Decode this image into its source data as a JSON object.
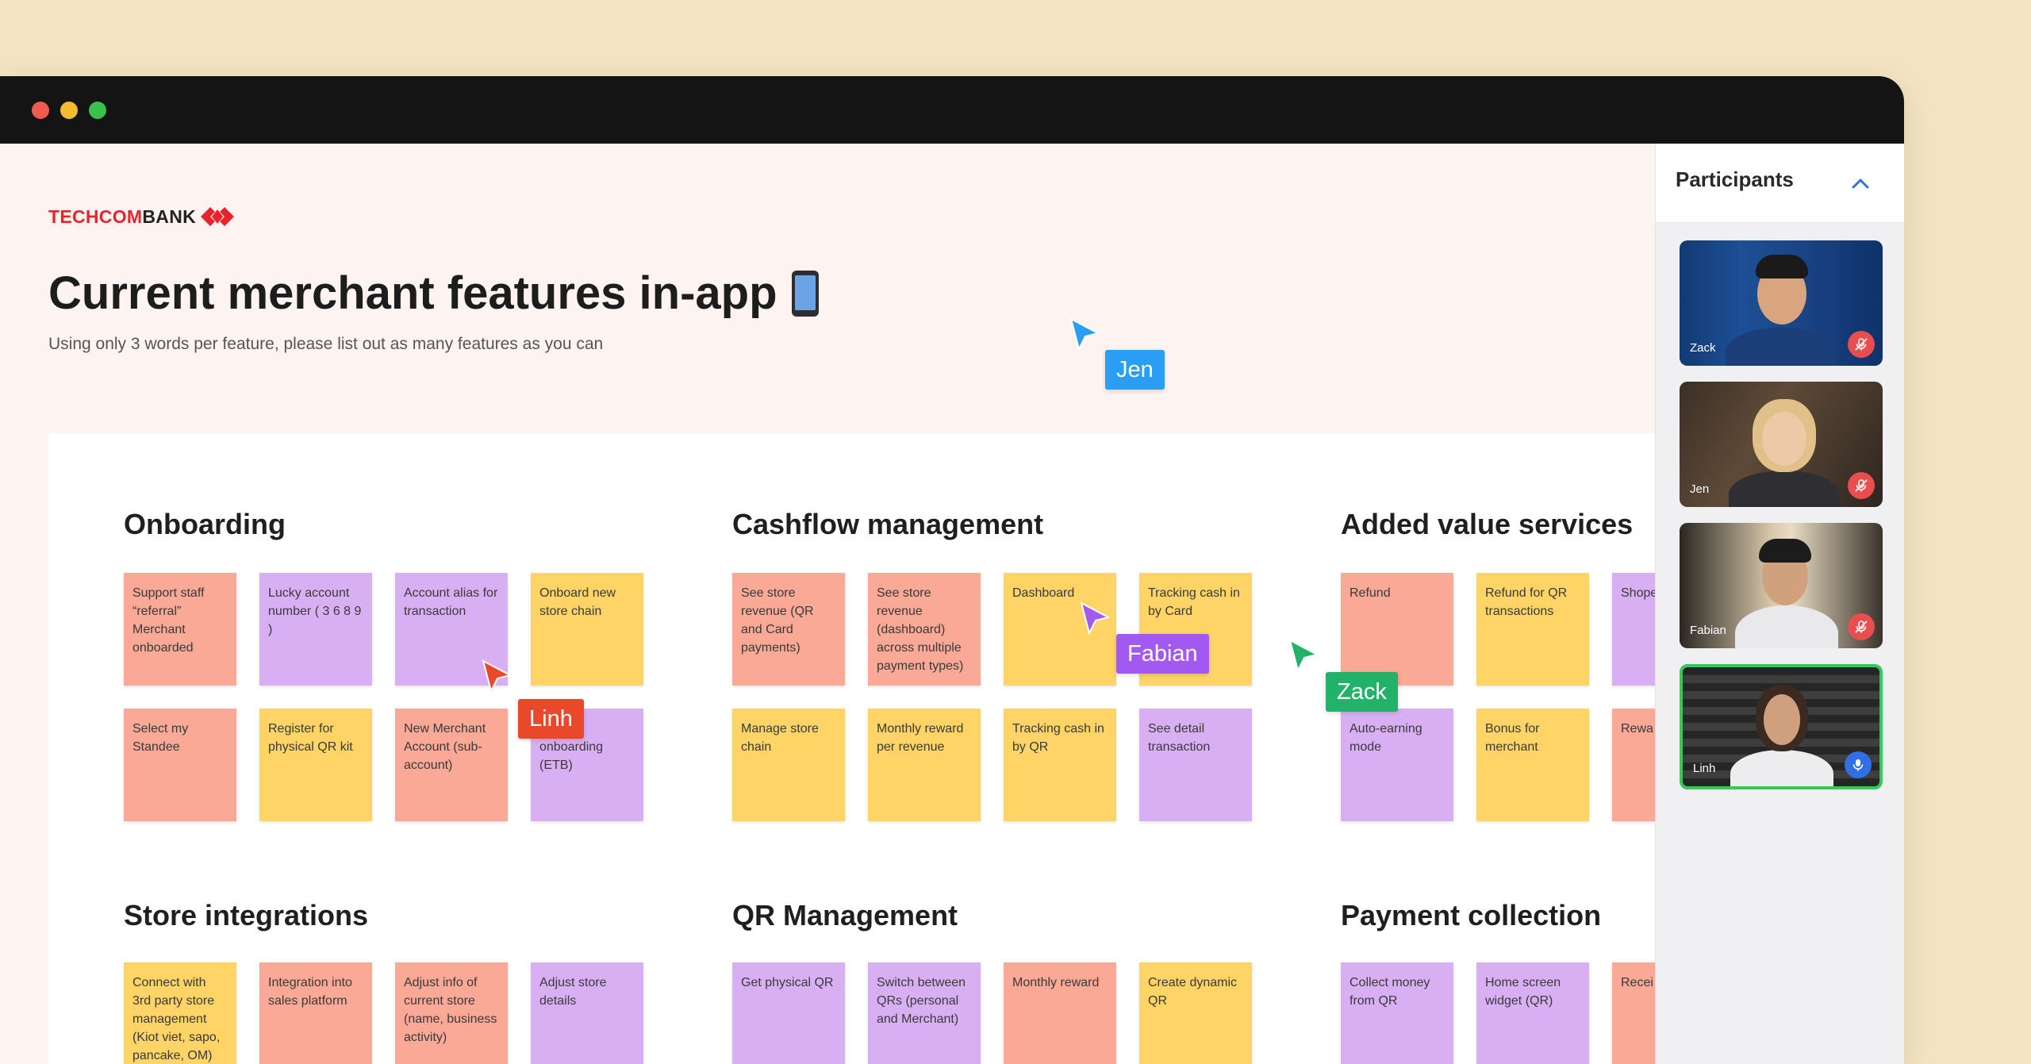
{
  "window": {
    "controls": [
      "close",
      "minimize",
      "zoom"
    ]
  },
  "brand": {
    "name_prefix": "TECHCOM",
    "name_suffix": "BANK",
    "logo_color": "#e8232a"
  },
  "page": {
    "title": "Current merchant features in-app",
    "title_emoji_icon": "mobile-phone-icon",
    "subtitle": "Using only 3 words per feature, please list out as many features as you can"
  },
  "colors": {
    "salmon": "#f9a995",
    "lavender": "#d8aff3",
    "yellow": "#fdd465",
    "jen": "#2a9df4",
    "fabian": "#a259f1",
    "linh": "#e9482b",
    "zack": "#23b26a",
    "active_speaker": "#35c85a"
  },
  "sections": {
    "onboarding": {
      "title": "Onboarding",
      "notes": [
        "Support staff “referral” Merchant onboarded",
        "Lucky account number ( 3 6 8 9 )",
        "Account alias for transaction",
        "Onboard new store chain",
        "Select my Standee",
        "Register for physical QR kit",
        "New Merchant Account (sub-account)",
        "onboarding (ETB)"
      ]
    },
    "cashflow": {
      "title": "Cashflow management",
      "notes": [
        "See store revenue (QR and Card payments)",
        "See store revenue (dashboard) across multiple payment types)",
        "Dashboard",
        "Tracking cash in by Card",
        "Manage store chain",
        "Monthly reward per revenue",
        "Tracking cash in by QR",
        "See detail transaction"
      ]
    },
    "added_value": {
      "title": "Added value services",
      "notes": [
        "Refund",
        "Refund for QR transactions",
        "Shope (over",
        "Auto-earning mode",
        "Bonus for merchant",
        "Rewa Merc"
      ]
    },
    "store_integrations": {
      "title": "Store integrations",
      "notes": [
        "Connect with 3rd party store management (Kiot viet, sapo, pancake, OM)",
        "Integration into sales platform",
        "Adjust info of current store (name, business activity)",
        "Adjust store details"
      ]
    },
    "qr_management": {
      "title": "QR Management",
      "notes": [
        "Get physical QR",
        "Switch between QRs (personal and Merchant)",
        "Monthly reward",
        "Create dynamic QR"
      ]
    },
    "payment_collection": {
      "title": "Payment collection",
      "notes": [
        "Collect money from QR",
        "Home screen widget (QR)",
        "Recei paym"
      ]
    }
  },
  "cursors": {
    "jen": "Jen",
    "fabian": "Fabian",
    "linh": "Linh",
    "zack": "Zack"
  },
  "participants": {
    "title": "Participants",
    "list": [
      {
        "name": "Zack",
        "mic": "muted"
      },
      {
        "name": "Jen",
        "mic": "muted"
      },
      {
        "name": "Fabian",
        "mic": "muted"
      },
      {
        "name": "Linh",
        "mic": "speaking"
      }
    ]
  }
}
